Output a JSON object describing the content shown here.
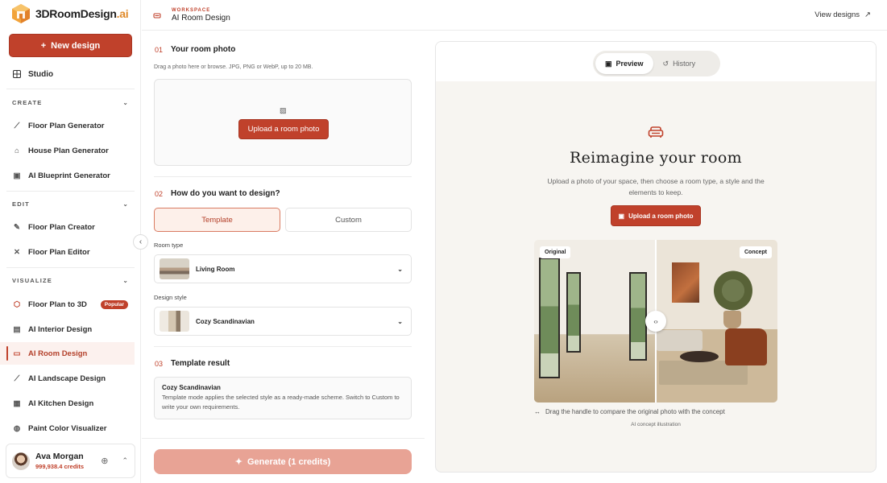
{
  "brand": {
    "name": "3DRoomDesign",
    "suffix": ".ai",
    "logo_icon": "cube-logo-icon"
  },
  "sidebar": {
    "new_design": "New design",
    "studio": "Studio",
    "sections": [
      {
        "title": "CREATE",
        "items": [
          "Floor Plan Generator",
          "House Plan Generator",
          "AI Blueprint Generator"
        ]
      },
      {
        "title": "EDIT",
        "items": [
          "Floor Plan Creator",
          "Floor Plan Editor"
        ]
      },
      {
        "title": "VISUALIZE",
        "items": [
          "Floor Plan to 3D",
          "AI Interior Design",
          "AI Room Design",
          "AI Landscape Design",
          "AI Kitchen Design",
          "Paint Color Visualizer"
        ]
      }
    ],
    "popular_badge": "Popular",
    "active_item": "AI Room Design"
  },
  "user": {
    "name": "Ava Morgan",
    "credits": "999,938.4 credits"
  },
  "topbar": {
    "workspace_label": "WORKSPACE",
    "title": "AI Room Design",
    "view_designs": "View designs"
  },
  "form": {
    "step1": {
      "num": "01",
      "title": "Your room photo",
      "hint": "Drag a photo here or browse. JPG, PNG or WebP, up to 20 MB.",
      "upload": "Upload a room photo"
    },
    "step2": {
      "num": "02",
      "title": "How do you want to design?",
      "mode_template": "Template",
      "mode_custom": "Custom",
      "room_type_label": "Room type",
      "room_type": "Living Room",
      "style_label": "Design style",
      "style": "Cozy Scandinavian"
    },
    "step3": {
      "num": "03",
      "title": "Template result",
      "result_title": "Cozy Scandinavian",
      "result_body": "Template mode applies the selected style as a ready-made scheme. Switch to Custom to write your own requirements."
    },
    "generate": "Generate (1 credits)"
  },
  "preview": {
    "tab_preview": "Preview",
    "tab_history": "History",
    "headline": "Reimagine your room",
    "description": "Upload a photo of your space, then choose a room type, a style and the elements to keep.",
    "cta": "Upload a room photo",
    "label_original": "Original",
    "label_concept": "Concept",
    "compare_hint": "Drag the handle to compare the original photo with the concept",
    "illustration_note": "AI concept illustration"
  },
  "colors": {
    "accent": "#c0412b",
    "accent_soft": "#fdf0ea",
    "generate_disabled": "#e8a395"
  }
}
